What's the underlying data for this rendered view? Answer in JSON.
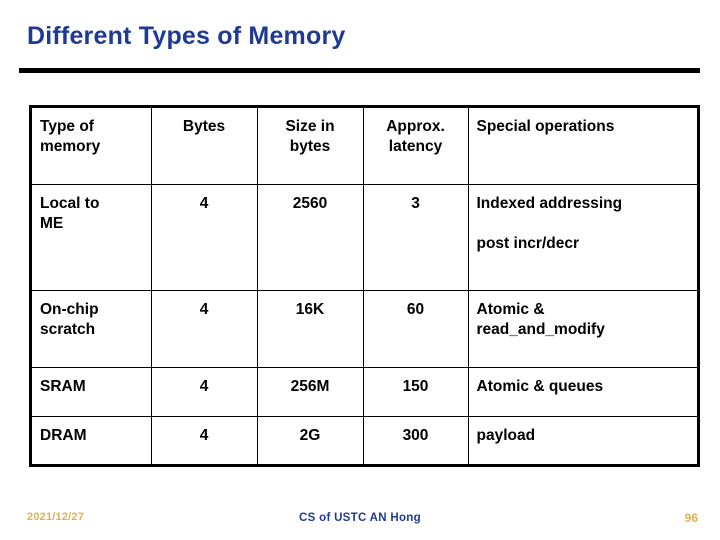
{
  "slide": {
    "title": "Different Types of Memory",
    "title_color": "#1F3A93",
    "rule_color": "#000000",
    "background": "#FFFFFF"
  },
  "table": {
    "headers": {
      "type": "Type of memory",
      "type_line1": "Type of",
      "type_line2": "memory",
      "bytes": "Bytes",
      "size_line1": "Size in",
      "size_line2": "bytes",
      "latency_line1": "Approx.",
      "latency_line2": "latency",
      "operations": "Special operations"
    },
    "rows": [
      {
        "type_line1": "Local to",
        "type_line2": "ME",
        "bytes": "4",
        "size": "2560",
        "latency": "3",
        "ops_line1": "Indexed addressing",
        "ops_line2": "post incr/decr"
      },
      {
        "type_line1": "On-chip",
        "type_line2": "scratch",
        "bytes": "4",
        "size": "16K",
        "latency": "60",
        "ops_line1": "Atomic &",
        "ops_line2": "read_and_modify"
      },
      {
        "type_line1": "SRAM",
        "type_line2": "",
        "bytes": "4",
        "size": "256M",
        "latency": "150",
        "ops_line1": "Atomic & queues",
        "ops_line2": ""
      },
      {
        "type_line1": "DRAM",
        "type_line2": "",
        "bytes": "4",
        "size": "2G",
        "latency": "300",
        "ops_line1": "payload",
        "ops_line2": ""
      }
    ]
  },
  "footer": {
    "date": "2021/12/27",
    "date_color": "#D9B25A",
    "center": "CS of USTC AN Hong",
    "center_color": "#1F3A93",
    "page": "96",
    "page_color": "#D9B25A"
  }
}
